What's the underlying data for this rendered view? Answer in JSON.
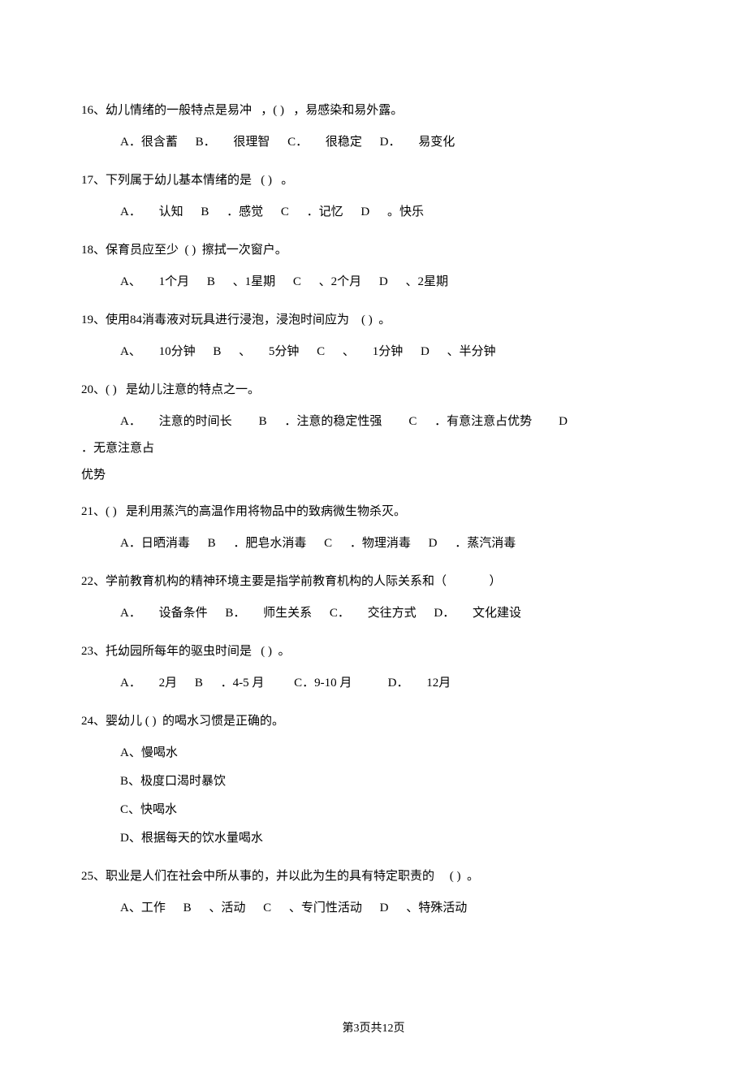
{
  "questions": [
    {
      "num": "16、",
      "text_a": "幼儿情绪的一般特点是易冲",
      "blank": "，(   )",
      "text_b": "，易感染和易外露。",
      "options": [
        "A．很含蓄",
        "B．",
        "很理智",
        "C．",
        "很稳定",
        "D．",
        "易变化"
      ]
    },
    {
      "num": "17、",
      "text_a": "下列属于幼儿基本情绪的是",
      "blank": "(   )",
      "text_b": "。",
      "options": [
        "A．",
        "认知",
        "B",
        "．感觉",
        "C",
        "．记忆",
        "D",
        "。快乐"
      ]
    },
    {
      "num": "18、",
      "text_a": "保育员应至少",
      "blank": "(   )",
      "text_b": "擦拭一次窗户。",
      "options": [
        "A、",
        "1个月",
        "B",
        "、1星期",
        "C",
        "、2个月",
        "D",
        "、2星期"
      ]
    },
    {
      "num": "19、",
      "text_a": "使用84消毒液对玩具进行浸泡，浸泡时间应为",
      "blank": "(   )",
      "text_b": "。",
      "options": [
        "A、",
        "10分钟",
        "B",
        "、",
        "5分钟",
        "C",
        "、",
        "1分钟",
        "D",
        "、半分钟"
      ]
    },
    {
      "num": "20、",
      "text_a": "(   )",
      "blank": "",
      "text_b": "是幼儿注意的特点之一。",
      "options": [
        "A．",
        "注意的时间长",
        "B",
        "．注意的稳定性强",
        "C",
        "．有意注意占优势",
        "D",
        "．无意注意占"
      ],
      "wrap_tail": "优势"
    },
    {
      "num": "21、",
      "text_a": "(   )",
      "blank": "",
      "text_b": "是利用蒸汽的高温作用将物品中的致病微生物杀灭。",
      "options": [
        "A．日晒消毒",
        "B",
        "．肥皂水消毒",
        "C",
        "．物理消毒",
        "D",
        "．蒸汽消毒"
      ]
    },
    {
      "num": "22、",
      "text_a": "学前教育机构的精神环境主要是指学前教育机构的人际关系和（",
      "blank": "",
      "text_b": "）",
      "options": [
        "A．",
        "设备条件",
        "B．",
        "师生关系",
        "C．",
        "交往方式",
        "D．",
        "文化建设"
      ]
    },
    {
      "num": "23、",
      "text_a": "托幼园所每年的驱虫时间是",
      "blank": "(   )",
      "text_b": "。",
      "options": [
        "A．",
        "2月",
        "B",
        "．4-5 月",
        "C．9-10 月",
        "D．",
        "12月"
      ]
    },
    {
      "num": "24、",
      "text_a": "婴幼儿",
      "blank": "(   )",
      "text_b": "的喝水习惯是正确的。",
      "vertical": true,
      "voptions": [
        "A、慢喝水",
        "B、极度口渴时暴饮",
        "C、快喝水",
        "D、根据每天的饮水量喝水"
      ]
    },
    {
      "num": "25、",
      "text_a": "职业是人们在社会中所从事的，并以此为生的具有特定职责的",
      "blank": "(   )",
      "text_b": "。",
      "options": [
        "A、工作",
        "B",
        "、活动",
        "C",
        "、专门性活动",
        "D",
        "、特殊活动"
      ]
    }
  ],
  "footer": "第3页共12页"
}
